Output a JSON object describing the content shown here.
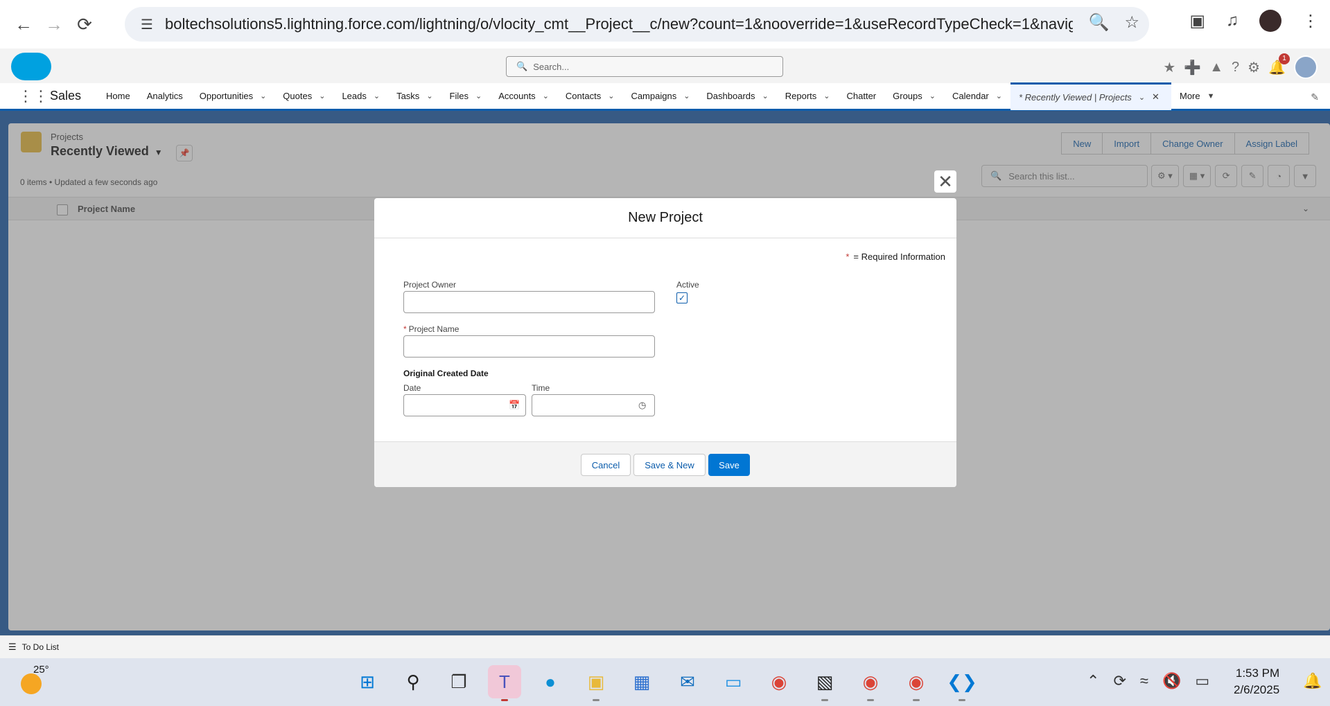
{
  "browser": {
    "url": "boltechsolutions5.lightning.force.com/lightning/o/vlocity_cmt__Project__c/new?count=1&nooverride=1&useRecordTypeCheck=1&navigati..."
  },
  "sf_header": {
    "search_placeholder": "Search...",
    "notification_count": "1"
  },
  "nav": {
    "app_name": "Sales",
    "items": [
      {
        "label": "Home",
        "has_menu": false
      },
      {
        "label": "Analytics",
        "has_menu": false
      },
      {
        "label": "Opportunities",
        "has_menu": true
      },
      {
        "label": "Quotes",
        "has_menu": true
      },
      {
        "label": "Leads",
        "has_menu": true
      },
      {
        "label": "Tasks",
        "has_menu": true
      },
      {
        "label": "Files",
        "has_menu": true
      },
      {
        "label": "Accounts",
        "has_menu": true
      },
      {
        "label": "Contacts",
        "has_menu": true
      },
      {
        "label": "Campaigns",
        "has_menu": true
      },
      {
        "label": "Dashboards",
        "has_menu": true
      },
      {
        "label": "Reports",
        "has_menu": true
      },
      {
        "label": "Chatter",
        "has_menu": false
      },
      {
        "label": "Groups",
        "has_menu": true
      },
      {
        "label": "Calendar",
        "has_menu": true
      }
    ],
    "active_tab": "* Recently Viewed | Projects",
    "more_label": "More"
  },
  "list_view": {
    "object_label": "Projects",
    "view_name": "Recently Viewed",
    "meta": "0 items • Updated a few seconds ago",
    "buttons": [
      "New",
      "Import",
      "Change Owner",
      "Assign Label"
    ],
    "search_placeholder": "Search this list...",
    "column_header": "Project Name"
  },
  "modal": {
    "title": "New Project",
    "required_info": "= Required Information",
    "owner_label": "Project Owner",
    "owner_value": "",
    "name_label": "Project Name",
    "name_value": "",
    "active_label": "Active",
    "active_checked": true,
    "section_label": "Original Created Date",
    "date_label": "Date",
    "time_label": "Time",
    "cancel_label": "Cancel",
    "save_new_label": "Save & New",
    "save_label": "Save"
  },
  "utility_bar": {
    "todo_label": "To Do List"
  },
  "taskbar": {
    "temperature": "25°",
    "time": "1:53 PM",
    "date": "2/6/2025"
  },
  "colors": {
    "brand_blue": "#0176d3",
    "nav_blue": "#0b5cab",
    "required_red": "#c23934"
  }
}
